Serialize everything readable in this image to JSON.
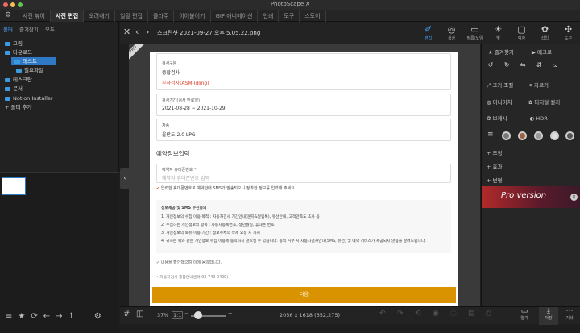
{
  "app": {
    "title": "PhotoScape X"
  },
  "menu": {
    "tabs": [
      "사진 뷰어",
      "사진 편집",
      "오려내기",
      "일괄 편집",
      "콜라주",
      "이어붙이기",
      "GIF 애니메이션",
      "인쇄",
      "도구",
      "스토어"
    ],
    "active": "사진 편집"
  },
  "left_panel": {
    "tabs": [
      "폴더",
      "즐겨찾기",
      "모두"
    ],
    "tree": [
      {
        "label": "그림",
        "indent": 0
      },
      {
        "label": "다운로드",
        "indent": 0
      },
      {
        "label": "테스트",
        "indent": 1
      },
      {
        "label": "필요파일",
        "indent": 1
      },
      {
        "label": "데스크탑",
        "indent": 0
      },
      {
        "label": "문서",
        "indent": 0
      },
      {
        "label": "Notion Installer",
        "indent": 0
      },
      {
        "label": "+ 폴더 추가",
        "indent": 0
      }
    ],
    "selected": "테스트"
  },
  "viewer": {
    "filename": "스크린샷 2021-09-27 오후 5.05.22.png",
    "pro_badge": "PRO"
  },
  "document": {
    "exam_type_label": "검사구분",
    "exam_type_value": "종합검사",
    "exam_type_sub": "부하검사(ASM-Idling)",
    "period_label": "검사기간(검사 만료일)",
    "period_value": "2021-08-28 ~ 2021-10-29",
    "car_label": "차종",
    "car_value": "올란도 2.0 LPG",
    "section_title": "예약정보입력",
    "phone_label": "예약자 휴대폰번호 *",
    "phone_placeholder": "예약자 휴대폰번호 입력",
    "notice": "입력한 휴대폰번호로 예약안내 SMS가 발송되오니 정확한 정보를 입력해 주세요.",
    "terms_title": "정보제공 및 SMS 수신동의",
    "terms_lines": [
      "1. 개인정보의 수집 이용 목적 : 자동차검사 기간안내(문자&알림톡), 유선안내, 고객만족도 조사 등",
      "2. 수집하는 개인정보의 항목 : 자동차등록번호, 생년월일, 휴대폰 번호",
      "3. 개인정보의 보유 이용 기간 : 정보주체의 삭제 요청 시 까지",
      "4. 귀하는 위와 같은 개인정보 수집 이용에 동의하지 않으실 수 있습니다. 동의 거부 시 자동차검사안내(SMS, 유선) 및 예약 서비스가 제공되지 않음을 알려드립니다."
    ],
    "agree": "내용을 확인했으며 이에 동의합니다.",
    "call_info": "자동차검사 종합안내센터(02-740-0499)",
    "next_button": "다음"
  },
  "tool_tabs": [
    {
      "icon": "✐",
      "label": "편집",
      "active": true
    },
    {
      "icon": "◎",
      "label": "색상"
    },
    {
      "icon": "▭",
      "label": "필름/노임"
    },
    {
      "icon": "☀",
      "label": "빛"
    },
    {
      "icon": "▢",
      "label": "액자"
    },
    {
      "icon": "✿",
      "label": "삽입"
    },
    {
      "icon": "✣",
      "label": "도구"
    }
  ],
  "right_panel": {
    "favorite": "즐겨찾기",
    "macro": "매크로",
    "crop_resize": "크기 조절",
    "crop": "자르기",
    "miniature": "미니어처",
    "digital_color": "디지털 컬러",
    "bokeh": "보케시",
    "hdr": "HDR",
    "adjust": "조정",
    "effect": "효과",
    "transform": "변형",
    "pro_banner": "Pro version"
  },
  "bottom_bar": {
    "zoom": "37%",
    "ratio": "1:1",
    "dimensions": "2056 x 1618 (652,275)",
    "open": "열기",
    "save": "저장",
    "more": "기타"
  }
}
